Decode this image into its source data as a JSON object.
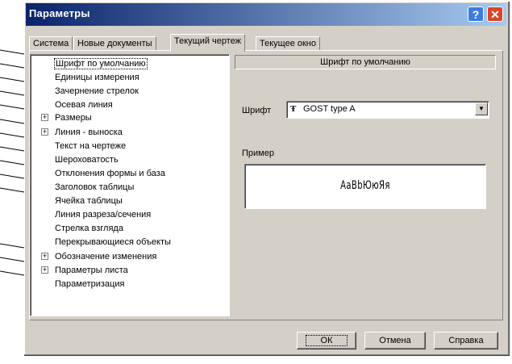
{
  "window": {
    "title": "Параметры",
    "help_glyph": "?",
    "close_glyph": "✕"
  },
  "tabs": [
    {
      "label": "Система",
      "active": false
    },
    {
      "label": "Новые документы",
      "active": false
    },
    {
      "label": "Текущий чертеж",
      "active": true
    },
    {
      "label": "Текущее окно",
      "active": false
    }
  ],
  "tree": {
    "items": [
      {
        "label": "Шрифт по умолчанию",
        "selected": true,
        "expandable": false
      },
      {
        "label": "Единицы измерения",
        "selected": false,
        "expandable": false
      },
      {
        "label": "Зачернение стрелок",
        "selected": false,
        "expandable": false
      },
      {
        "label": "Осевая линия",
        "selected": false,
        "expandable": false
      },
      {
        "label": "Размеры",
        "selected": false,
        "expandable": true
      },
      {
        "label": "Линия - выноска",
        "selected": false,
        "expandable": true
      },
      {
        "label": "Текст на чертеже",
        "selected": false,
        "expandable": false
      },
      {
        "label": "Шероховатость",
        "selected": false,
        "expandable": false
      },
      {
        "label": "Отклонения формы и база",
        "selected": false,
        "expandable": false
      },
      {
        "label": "Заголовок таблицы",
        "selected": false,
        "expandable": false
      },
      {
        "label": "Ячейка таблицы",
        "selected": false,
        "expandable": false
      },
      {
        "label": "Линия разреза/сечения",
        "selected": false,
        "expandable": false
      },
      {
        "label": "Стрелка взгляда",
        "selected": false,
        "expandable": false
      },
      {
        "label": "Перекрывающиеся объекты",
        "selected": false,
        "expandable": false
      },
      {
        "label": "Обозначение изменения",
        "selected": false,
        "expandable": true
      },
      {
        "label": "Параметры листа",
        "selected": false,
        "expandable": true
      },
      {
        "label": "Параметризация",
        "selected": false,
        "expandable": false
      }
    ],
    "expander_glyph": "+"
  },
  "panel": {
    "header": "Шрифт по умолчанию",
    "font_label": "Шрифт",
    "font_value": "GOST type A",
    "font_icon": "truetype-font-icon",
    "font_icon_glyph": "Ŧ",
    "dropdown_glyph": "▼",
    "example_label": "Пример",
    "example_text": "АаВbЮюЯя"
  },
  "buttons": {
    "ok": "ОК",
    "cancel": "Отмена",
    "help": "Справка"
  },
  "colors": {
    "titlebar_start": "#0a246a",
    "titlebar_end": "#a6caf0",
    "face": "#d4d0c8"
  }
}
